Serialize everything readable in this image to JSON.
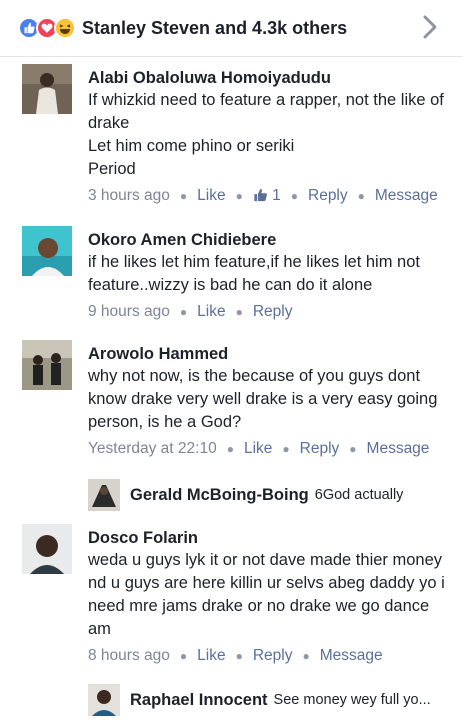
{
  "reactions": {
    "text": "Stanley Steven and 4.3k others",
    "icons": [
      "like-icon",
      "love-icon",
      "haha-icon"
    ],
    "colors": {
      "like": "#4a7ff2",
      "love": "#f0425a",
      "haha": "#f7c33b"
    }
  },
  "actions": {
    "like": "Like",
    "reply": "Reply",
    "message": "Message"
  },
  "comments": [
    {
      "name": "Alabi Obaloluwa Homoiyadudu",
      "text": "If whizkid need to feature a rapper, not the like of drake\n Let him come phino  or seriki\nPeriod",
      "time": "3 hours ago",
      "like_count": "1"
    },
    {
      "name": "Okoro Amen Chidiebere",
      "text": "if he likes let him feature,if he likes let him not feature..wizzy is bad he can do it alone",
      "time": "9 hours ago"
    },
    {
      "name": "Arowolo Hammed",
      "text": "why not now, is the because of you guys dont know drake very well drake is a very easy going person,  is he a God?",
      "time": "Yesterday at 22:10",
      "reply": {
        "name": "Gerald McBoing-Boing",
        "text": "6God actually"
      }
    },
    {
      "name": "Dosco Folarin",
      "text": "weda u guys lyk it or not dave made thier money nd u guys are here killin ur selvs abeg daddy yo i need mre jams drake or no drake we go dance am",
      "time": "8 hours ago",
      "reply": {
        "name": "Raphael Innocent",
        "text": "See money wey full yo..."
      }
    }
  ]
}
